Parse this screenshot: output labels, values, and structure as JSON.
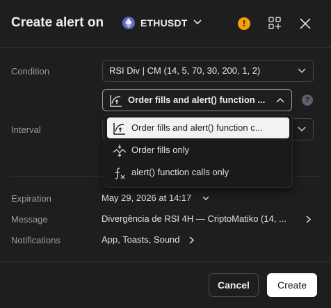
{
  "header": {
    "title": "Create alert on",
    "symbol": "ETHUSDT",
    "symbol_icon": "ethereum-icon",
    "warning_icon": "warning-icon",
    "warning_glyph": "!",
    "add_icon": "add-widget-icon",
    "close_icon": "close-icon"
  },
  "condition": {
    "label": "Condition",
    "indicator": "RSI Div | CM (14, 5, 70, 30, 200, 1, 2)",
    "trigger": "Order fills and alert() function ..."
  },
  "help_glyph": "?",
  "interval": {
    "label": "Interval"
  },
  "trigger_options": [
    {
      "label": "Order fills and alert() function c...",
      "icon": "order-fills-alert-icon",
      "selected": true
    },
    {
      "label": "Order fills only",
      "icon": "order-fills-icon",
      "selected": false
    },
    {
      "label": "alert() function calls only",
      "icon": "function-icon",
      "selected": false
    }
  ],
  "expiration": {
    "label": "Expiration",
    "value": "May 29, 2026 at 14:17"
  },
  "message": {
    "label": "Message",
    "value": "Divergência de RSI 4H — CriptoMatiko (14, ..."
  },
  "notifications": {
    "label": "Notifications",
    "value": "App, Toasts, Sound"
  },
  "buttons": {
    "cancel": "Cancel",
    "create": "Create"
  },
  "colors": {
    "background": "#1e1e1e",
    "warning": "#f59e0b",
    "eth": "#5c6bc0",
    "primary_button": "#ffffff"
  }
}
